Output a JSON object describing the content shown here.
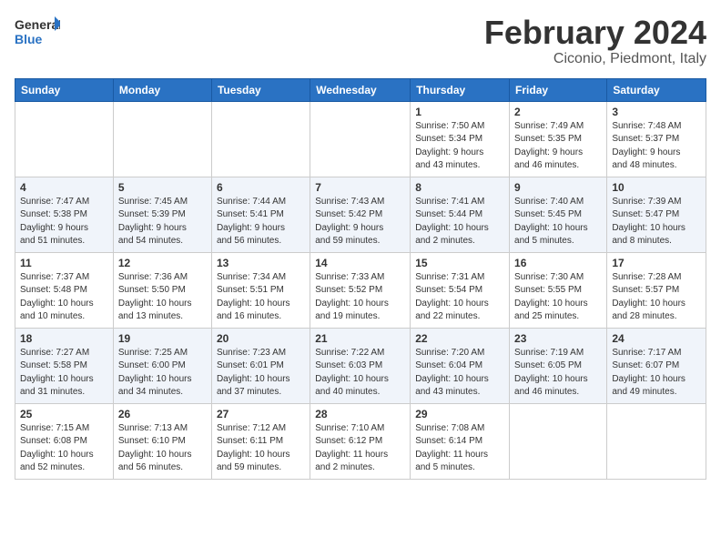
{
  "header": {
    "logo_line1": "General",
    "logo_line2": "Blue",
    "month": "February 2024",
    "location": "Ciconio, Piedmont, Italy"
  },
  "days_of_week": [
    "Sunday",
    "Monday",
    "Tuesday",
    "Wednesday",
    "Thursday",
    "Friday",
    "Saturday"
  ],
  "weeks": [
    [
      {
        "day": "",
        "info": ""
      },
      {
        "day": "",
        "info": ""
      },
      {
        "day": "",
        "info": ""
      },
      {
        "day": "",
        "info": ""
      },
      {
        "day": "1",
        "info": "Sunrise: 7:50 AM\nSunset: 5:34 PM\nDaylight: 9 hours\nand 43 minutes."
      },
      {
        "day": "2",
        "info": "Sunrise: 7:49 AM\nSunset: 5:35 PM\nDaylight: 9 hours\nand 46 minutes."
      },
      {
        "day": "3",
        "info": "Sunrise: 7:48 AM\nSunset: 5:37 PM\nDaylight: 9 hours\nand 48 minutes."
      }
    ],
    [
      {
        "day": "4",
        "info": "Sunrise: 7:47 AM\nSunset: 5:38 PM\nDaylight: 9 hours\nand 51 minutes."
      },
      {
        "day": "5",
        "info": "Sunrise: 7:45 AM\nSunset: 5:39 PM\nDaylight: 9 hours\nand 54 minutes."
      },
      {
        "day": "6",
        "info": "Sunrise: 7:44 AM\nSunset: 5:41 PM\nDaylight: 9 hours\nand 56 minutes."
      },
      {
        "day": "7",
        "info": "Sunrise: 7:43 AM\nSunset: 5:42 PM\nDaylight: 9 hours\nand 59 minutes."
      },
      {
        "day": "8",
        "info": "Sunrise: 7:41 AM\nSunset: 5:44 PM\nDaylight: 10 hours\nand 2 minutes."
      },
      {
        "day": "9",
        "info": "Sunrise: 7:40 AM\nSunset: 5:45 PM\nDaylight: 10 hours\nand 5 minutes."
      },
      {
        "day": "10",
        "info": "Sunrise: 7:39 AM\nSunset: 5:47 PM\nDaylight: 10 hours\nand 8 minutes."
      }
    ],
    [
      {
        "day": "11",
        "info": "Sunrise: 7:37 AM\nSunset: 5:48 PM\nDaylight: 10 hours\nand 10 minutes."
      },
      {
        "day": "12",
        "info": "Sunrise: 7:36 AM\nSunset: 5:50 PM\nDaylight: 10 hours\nand 13 minutes."
      },
      {
        "day": "13",
        "info": "Sunrise: 7:34 AM\nSunset: 5:51 PM\nDaylight: 10 hours\nand 16 minutes."
      },
      {
        "day": "14",
        "info": "Sunrise: 7:33 AM\nSunset: 5:52 PM\nDaylight: 10 hours\nand 19 minutes."
      },
      {
        "day": "15",
        "info": "Sunrise: 7:31 AM\nSunset: 5:54 PM\nDaylight: 10 hours\nand 22 minutes."
      },
      {
        "day": "16",
        "info": "Sunrise: 7:30 AM\nSunset: 5:55 PM\nDaylight: 10 hours\nand 25 minutes."
      },
      {
        "day": "17",
        "info": "Sunrise: 7:28 AM\nSunset: 5:57 PM\nDaylight: 10 hours\nand 28 minutes."
      }
    ],
    [
      {
        "day": "18",
        "info": "Sunrise: 7:27 AM\nSunset: 5:58 PM\nDaylight: 10 hours\nand 31 minutes."
      },
      {
        "day": "19",
        "info": "Sunrise: 7:25 AM\nSunset: 6:00 PM\nDaylight: 10 hours\nand 34 minutes."
      },
      {
        "day": "20",
        "info": "Sunrise: 7:23 AM\nSunset: 6:01 PM\nDaylight: 10 hours\nand 37 minutes."
      },
      {
        "day": "21",
        "info": "Sunrise: 7:22 AM\nSunset: 6:03 PM\nDaylight: 10 hours\nand 40 minutes."
      },
      {
        "day": "22",
        "info": "Sunrise: 7:20 AM\nSunset: 6:04 PM\nDaylight: 10 hours\nand 43 minutes."
      },
      {
        "day": "23",
        "info": "Sunrise: 7:19 AM\nSunset: 6:05 PM\nDaylight: 10 hours\nand 46 minutes."
      },
      {
        "day": "24",
        "info": "Sunrise: 7:17 AM\nSunset: 6:07 PM\nDaylight: 10 hours\nand 49 minutes."
      }
    ],
    [
      {
        "day": "25",
        "info": "Sunrise: 7:15 AM\nSunset: 6:08 PM\nDaylight: 10 hours\nand 52 minutes."
      },
      {
        "day": "26",
        "info": "Sunrise: 7:13 AM\nSunset: 6:10 PM\nDaylight: 10 hours\nand 56 minutes."
      },
      {
        "day": "27",
        "info": "Sunrise: 7:12 AM\nSunset: 6:11 PM\nDaylight: 10 hours\nand 59 minutes."
      },
      {
        "day": "28",
        "info": "Sunrise: 7:10 AM\nSunset: 6:12 PM\nDaylight: 11 hours\nand 2 minutes."
      },
      {
        "day": "29",
        "info": "Sunrise: 7:08 AM\nSunset: 6:14 PM\nDaylight: 11 hours\nand 5 minutes."
      },
      {
        "day": "",
        "info": ""
      },
      {
        "day": "",
        "info": ""
      }
    ]
  ]
}
